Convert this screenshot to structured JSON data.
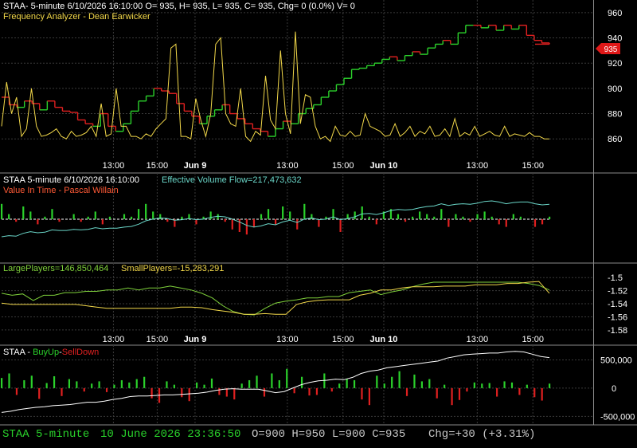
{
  "colors": {
    "background": "#000000",
    "grid": "#3a3a3a",
    "axis_text": "#ffffff",
    "up": "#2bd12b",
    "down": "#e02020",
    "osc": "#f2d84a",
    "teal": "#6ad6c8",
    "lime": "#7fd13b",
    "value_in_time": "#ff5a36",
    "status_green": "#29d12b",
    "status_grey": "#c8c8c8",
    "price_badge": "#e01818"
  },
  "panel1": {
    "header": "STAA- 5-minute 6/10/2026 16:10:00 O= 935, H= 935, L= 935, C= 935, Chg= 0 (0.0%) V= 0",
    "indicator": "Frequency Analyzer - Dean Earwicker",
    "price_badge": "935"
  },
  "panel2": {
    "header_left": "STAA 5-minute  6/10/2026 16:10:00",
    "header_right": "Effective Volume Flow=217,473,632",
    "indicator": "Value In Time - Pascal Willain"
  },
  "panel3": {
    "large_label": "LargePlayers=146,850,464",
    "small_label": "SmallPlayers=-15,283,291"
  },
  "panel4": {
    "title_prefix": "STAA - ",
    "buy_label": "BuyUp",
    "sep": "-",
    "sell_label": "SellDown"
  },
  "status": {
    "symbol": "STAA  5-minute",
    "datetime": "10 June 2026 23:36:50",
    "ohlc": "O=900  H=950  L=900  C=935",
    "chg": "Chg=+30 (+3.31%)"
  },
  "chart_data": [
    {
      "type": "line",
      "name": "price",
      "ylim": [
        845,
        970
      ],
      "yticks": [
        860,
        880,
        900,
        920,
        940,
        960
      ],
      "xticks": [
        "13:00",
        "15:00",
        "Jun 9",
        "13:00",
        "15:00",
        "Jun 10",
        "13:00",
        "15:00"
      ],
      "tick_positions": [
        0.189,
        0.263,
        0.327,
        0.483,
        0.577,
        0.646,
        0.804,
        0.898
      ],
      "last_value": 935,
      "price_bar_closes": [
        893,
        887,
        885,
        890,
        888,
        883,
        890,
        885,
        882,
        881,
        875,
        872,
        870,
        880,
        870,
        866,
        872,
        882,
        890,
        894,
        900,
        898,
        896,
        888,
        882,
        878,
        872,
        878,
        883,
        887,
        880,
        876,
        872,
        868,
        866,
        862,
        868,
        874,
        872,
        880,
        884,
        887,
        893,
        898,
        903,
        908,
        915,
        916,
        918,
        920,
        923,
        925,
        922,
        926,
        929,
        927,
        932,
        935,
        938,
        935,
        944,
        950,
        950,
        948,
        950,
        946,
        950,
        947,
        950,
        942,
        938,
        936,
        935
      ],
      "freq_analyzer": [
        870,
        905,
        880,
        893,
        862,
        868,
        900,
        870,
        862,
        863,
        865,
        868,
        862,
        860,
        866,
        862,
        863,
        865,
        870,
        862,
        888,
        862,
        864,
        900,
        870,
        870,
        862,
        862,
        860,
        864,
        862,
        868,
        872,
        876,
        932,
        935,
        862,
        862,
        860,
        892,
        875,
        862,
        880,
        935,
        940,
        880,
        872,
        870,
        900,
        862,
        858,
        866,
        863,
        910,
        875,
        868,
        930,
        880,
        864,
        945,
        872,
        895,
        893,
        870,
        860,
        862,
        858,
        870,
        863,
        862,
        866,
        862,
        863,
        880,
        870,
        868,
        866,
        862,
        863,
        872,
        862,
        865,
        870,
        862,
        866,
        864,
        870,
        862,
        863,
        868,
        862,
        876,
        862,
        865,
        863,
        870,
        862,
        864,
        866,
        863,
        862,
        870,
        862,
        864,
        863,
        862,
        865,
        862,
        862,
        860,
        860
      ]
    },
    {
      "type": "bar",
      "name": "value_in_time",
      "effective_volume_flow_label": "Effective Volume Flow",
      "values": [
        6,
        2,
        -1,
        5,
        3,
        -2,
        1,
        4,
        -1,
        0,
        2,
        -1,
        1,
        3,
        -2,
        1,
        0,
        2,
        1,
        4,
        6,
        3,
        2,
        -1,
        -3,
        1,
        2,
        -2,
        1,
        3,
        2,
        -1,
        -4,
        -5,
        -6,
        -3,
        2,
        4,
        -2,
        5,
        3,
        -4,
        6,
        2,
        -3,
        1,
        4,
        -5,
        2,
        3,
        5,
        1,
        -2,
        3,
        4,
        2,
        -1,
        1,
        3,
        2,
        1,
        4,
        -3,
        2,
        1,
        -1,
        2,
        3,
        1,
        -2,
        -3,
        2,
        1,
        0,
        -3,
        -2,
        1
      ]
    },
    {
      "type": "line",
      "name": "large_small_players",
      "ylim": [
        -1.585,
        -1.49
      ],
      "yticks": [
        -1.5,
        -1.52,
        -1.54,
        -1.56,
        -1.58
      ],
      "large_players": [
        -1.524,
        -1.527,
        -1.525,
        -1.535,
        -1.527,
        -1.527,
        -1.523,
        -1.523,
        -1.521,
        -1.521,
        -1.519,
        -1.519,
        -1.516,
        -1.519,
        -1.516,
        -1.516,
        -1.513,
        -1.516,
        -1.519,
        -1.524,
        -1.531,
        -1.543,
        -1.552,
        -1.556,
        -1.557,
        -1.547,
        -1.539,
        -1.536,
        -1.534,
        -1.531,
        -1.531,
        -1.529,
        -1.529,
        -1.523,
        -1.521,
        -1.519,
        -1.526,
        -1.522,
        -1.519,
        -1.514,
        -1.51,
        -1.507,
        -1.507,
        -1.507,
        -1.507,
        -1.507,
        -1.507,
        -1.507,
        -1.507,
        -1.507,
        -1.509,
        -1.512,
        -1.519
      ],
      "small_players": [
        -1.539,
        -1.541,
        -1.541,
        -1.541,
        -1.541,
        -1.541,
        -1.541,
        -1.541,
        -1.543,
        -1.545,
        -1.547,
        -1.547,
        -1.547,
        -1.547,
        -1.547,
        -1.547,
        -1.547,
        -1.545,
        -1.545,
        -1.546,
        -1.549,
        -1.551,
        -1.553,
        -1.556,
        -1.556,
        -1.555,
        -1.556,
        -1.556,
        -1.541,
        -1.537,
        -1.535,
        -1.534,
        -1.534,
        -1.534,
        -1.527,
        -1.524,
        -1.519,
        -1.519,
        -1.516,
        -1.514,
        -1.514,
        -1.514,
        -1.513,
        -1.513,
        -1.513,
        -1.511,
        -1.511,
        -1.511,
        -1.509,
        -1.509,
        -1.507,
        -1.506,
        -1.524
      ]
    },
    {
      "type": "bar",
      "name": "buyup_selldown",
      "ylim": [
        -650000,
        760000
      ],
      "yticks": [
        500000,
        0,
        -500000
      ],
      "ytick_labels": [
        "500,000",
        "0",
        "-500,000"
      ],
      "values": [
        180000,
        260000,
        -120000,
        140000,
        220000,
        -190000,
        90000,
        210000,
        -140000,
        160000,
        120000,
        -60000,
        80000,
        120000,
        -70000,
        60000,
        140000,
        100000,
        160000,
        200000,
        -180000,
        -260000,
        120000,
        60000,
        -160000,
        -230000,
        100000,
        60000,
        170000,
        -120000,
        -150000,
        -200000,
        80000,
        140000,
        220000,
        -150000,
        260000,
        140000,
        340000,
        -90000,
        200000,
        -130000,
        -120000,
        260000,
        -60000,
        80000,
        160000,
        140000,
        -200000,
        -300000,
        220000,
        80000,
        200000,
        300000,
        -140000,
        240000,
        120000,
        160000,
        -180000,
        60000,
        -300000,
        -210000,
        -60000,
        100000,
        80000,
        90000,
        -150000,
        120000,
        100000,
        -120000,
        60000,
        -160000,
        -220000,
        80000
      ],
      "cumulative": [
        -430000,
        -410000,
        -380000,
        -360000,
        -340000,
        -330000,
        -310000,
        -300000,
        -290000,
        -270000,
        -250000,
        -250000,
        -230000,
        -200000,
        -180000,
        -150000,
        -140000,
        -140000,
        -130000,
        -120000,
        -120000,
        -110000,
        -100000,
        -90000,
        -70000,
        -40000,
        -20000,
        -10000,
        -20000,
        -20000,
        -20000,
        -50000,
        -80000,
        -60000,
        0,
        60000,
        100000,
        130000,
        140000,
        160000,
        150000,
        190000,
        260000,
        300000,
        320000,
        360000,
        380000,
        400000,
        420000,
        440000,
        460000,
        480000,
        530000,
        560000,
        590000,
        600000,
        610000,
        620000,
        620000,
        640000,
        650000,
        640000,
        600000,
        560000,
        540000
      ]
    }
  ]
}
